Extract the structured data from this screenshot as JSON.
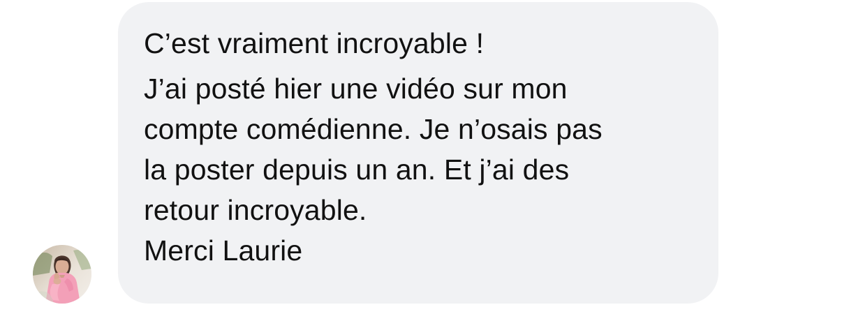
{
  "message": {
    "greeting": "C’est vraiment incroyable !",
    "body_lines": [
      "J’ai posté hier une vidéo sur mon",
      "compte comédienne. Je n’osais pas",
      "la poster depuis un an. Et j’ai des",
      "retour incroyable."
    ],
    "signoff": "Merci Laurie"
  },
  "colors": {
    "bubble_background": "#f1f2f4",
    "text": "#111111",
    "page_background": "#ffffff"
  },
  "icons": {
    "avatar": "profile-photo-icon"
  }
}
